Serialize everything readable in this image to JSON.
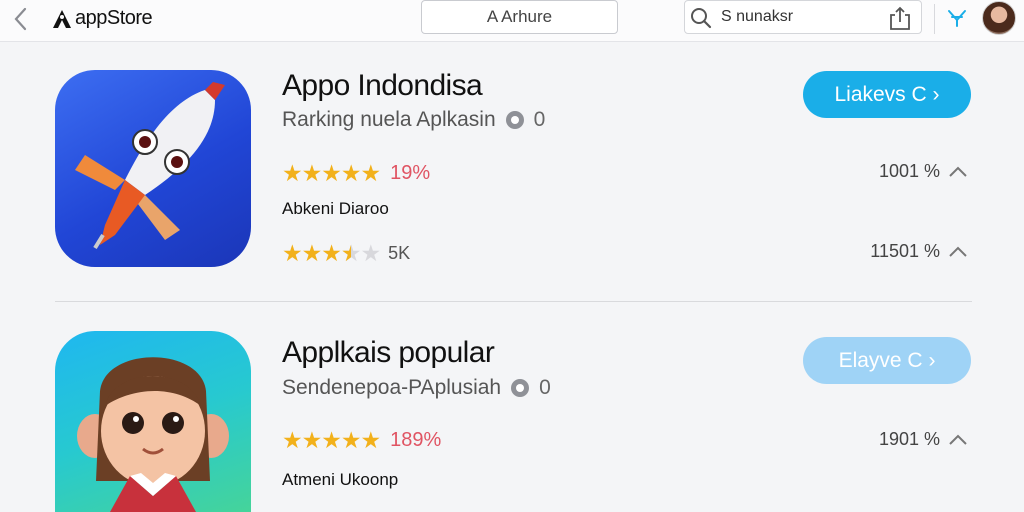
{
  "topbar": {
    "logo_text": "appStore",
    "center_button": "A Arhure",
    "search_text": "S nunaksr"
  },
  "apps": [
    {
      "title": "Appo Indondisa",
      "subtitle": "Rarking nuela Aplkasin",
      "subtitle_count": "0",
      "rating_stars": 5,
      "rating_percent": "19%",
      "developer": "Abkeni Diaroo",
      "stat1": "1001 %",
      "second_rating_stars": 3.5,
      "second_rating_text": "5K",
      "stat2": "11501 %",
      "button_label": "Liakevs C"
    },
    {
      "title": "Applkais popular",
      "subtitle": "Sendenepoa-PAplusiah",
      "subtitle_count": "0",
      "rating_stars": 5,
      "rating_percent": "189%",
      "developer": "Atmeni Ukoonp",
      "stat1": "1901 %",
      "button_label": "Elayve C"
    }
  ],
  "colors": {
    "accent": "#1aaee8",
    "accent_faded": "#9fd3f6",
    "star": "#f2b11b",
    "percent_red": "#e05463"
  }
}
